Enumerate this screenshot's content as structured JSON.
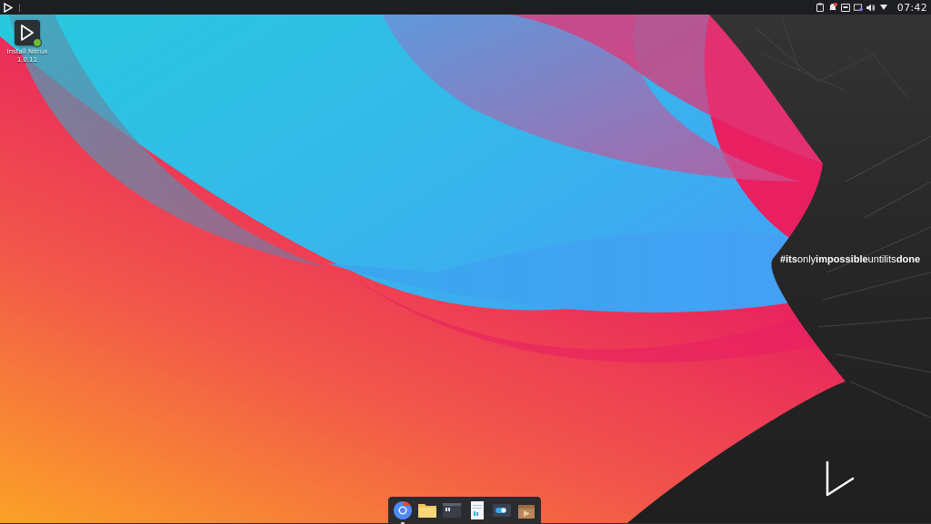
{
  "topbar": {
    "launcher_icon": "nitrux-logo-icon",
    "tray": [
      {
        "name": "clipboard-icon"
      },
      {
        "name": "notifications-icon"
      },
      {
        "name": "keyboard-icon"
      },
      {
        "name": "display-icon"
      },
      {
        "name": "volume-icon"
      },
      {
        "name": "network-icon"
      }
    ],
    "clock": "07:42"
  },
  "desktop": {
    "icons": [
      {
        "label_line1": "Install Nitrux",
        "label_line2": "1.0.11",
        "icon": "nitrux-installer-icon"
      }
    ]
  },
  "wallpaper": {
    "slogan": {
      "part1": "#its",
      "part2": "only",
      "part3": "impossible",
      "part4": "untilits",
      "part5": "done"
    },
    "colors": {
      "cyan": "#2fc6e2",
      "blue": "#3fa3f0",
      "pink": "#e81f63",
      "orange": "#f6a22a",
      "dark": "#2b2b2b"
    }
  },
  "dock": {
    "items": [
      {
        "name": "chromium-icon"
      },
      {
        "name": "file-manager-icon"
      },
      {
        "name": "terminal-icon"
      },
      {
        "name": "text-editor-icon"
      },
      {
        "name": "settings-icon"
      },
      {
        "name": "package-installer-icon"
      }
    ]
  }
}
